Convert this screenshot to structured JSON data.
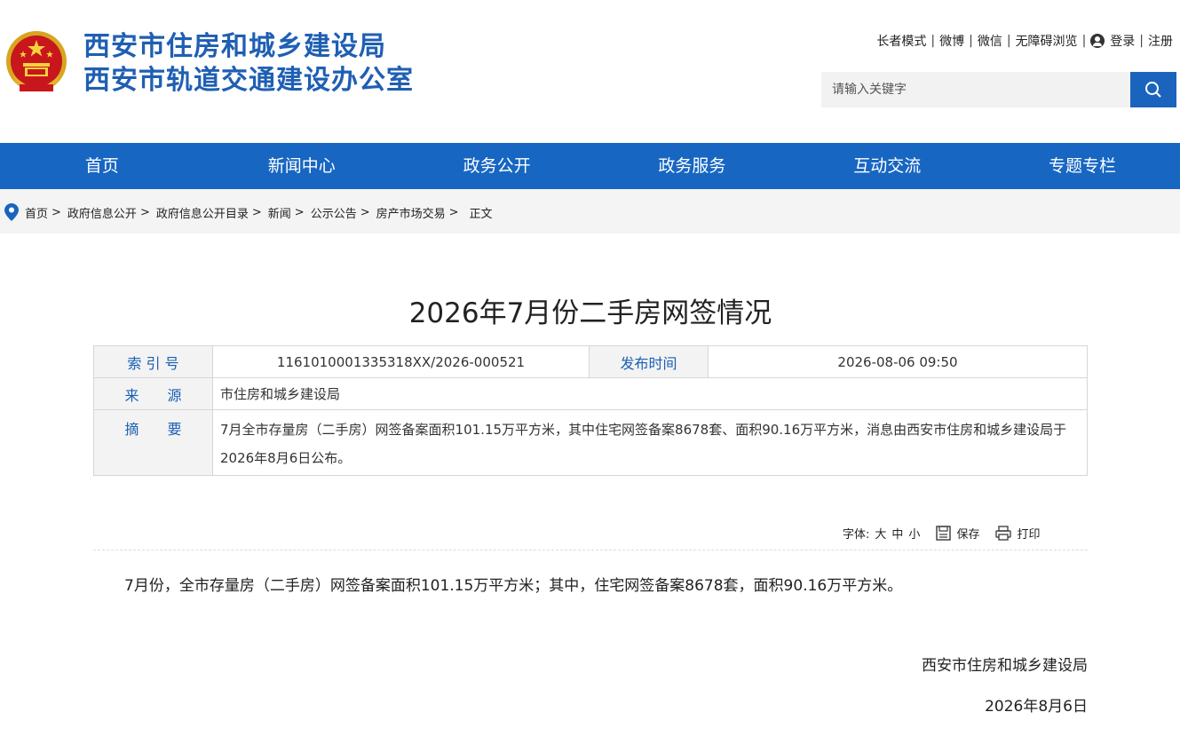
{
  "header": {
    "title_line1": "西安市住房和城乡建设局",
    "title_line2": "西安市轨道交通建设办公室",
    "links": {
      "elder_mode": "长者模式",
      "weibo": "微博",
      "wechat": "微信",
      "accessible": "无障碍浏览",
      "login": "登录",
      "register": "注册"
    },
    "search_placeholder": "请输入关键字"
  },
  "nav": [
    "首页",
    "新闻中心",
    "政务公开",
    "政务服务",
    "互动交流",
    "专题专栏"
  ],
  "breadcrumb": [
    "首页",
    "政府信息公开",
    "政府信息公开目录",
    "新闻",
    "公示公告",
    "房产市场交易",
    "正文"
  ],
  "article": {
    "title": "2026年7月份二手房网签情况",
    "meta": {
      "index_label": "索 引 号",
      "index_value": "1161010001335318XX/2026-000521",
      "publish_label": "发布时间",
      "publish_value": "2026-08-06 09:50",
      "source_label": "来　　源",
      "source_value": "市住房和城乡建设局",
      "abstract_label": "摘　　要",
      "abstract_value": "7月全市存量房（二手房）网签备案面积101.15万平方米，其中住宅网签备案8678套、面积90.16万平方米，消息由西安市住房和城乡建设局于2026年8月6日公布。"
    },
    "tools": {
      "font_label": "字体:",
      "big": "大",
      "medium": "中",
      "small": "小",
      "save": "保存",
      "print": "打印"
    },
    "body": "7月份，全市存量房（二手房）网签备案面积101.15万平方米；其中，住宅网签备案8678套，面积90.16万平方米。",
    "signature": "西安市住房和城乡建设局",
    "date": "2026年8月6日"
  }
}
